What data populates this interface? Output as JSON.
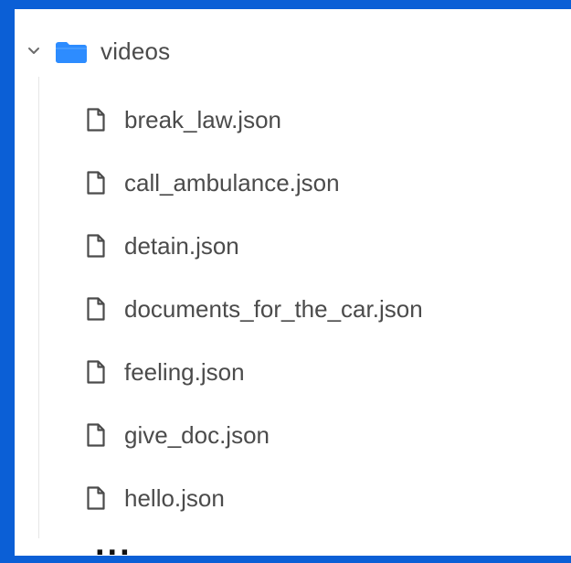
{
  "folder": {
    "name": "videos",
    "expanded": true,
    "icons": {
      "chevron": "chevron-down-icon",
      "folder": "folder-icon"
    }
  },
  "files": [
    {
      "name": "break_law.json",
      "icon": "file-icon"
    },
    {
      "name": "call_ambulance.json",
      "icon": "file-icon"
    },
    {
      "name": "detain.json",
      "icon": "file-icon"
    },
    {
      "name": "documents_for_the_car.json",
      "icon": "file-icon"
    },
    {
      "name": "feeling.json",
      "icon": "file-icon"
    },
    {
      "name": "give_doc.json",
      "icon": "file-icon"
    },
    {
      "name": "hello.json",
      "icon": "file-icon"
    }
  ],
  "more_indicator": "...",
  "colors": {
    "frame": "#0b5fd6",
    "panel": "#ffffff",
    "folder": "#2d8cff",
    "text": "#4b4b4b"
  }
}
